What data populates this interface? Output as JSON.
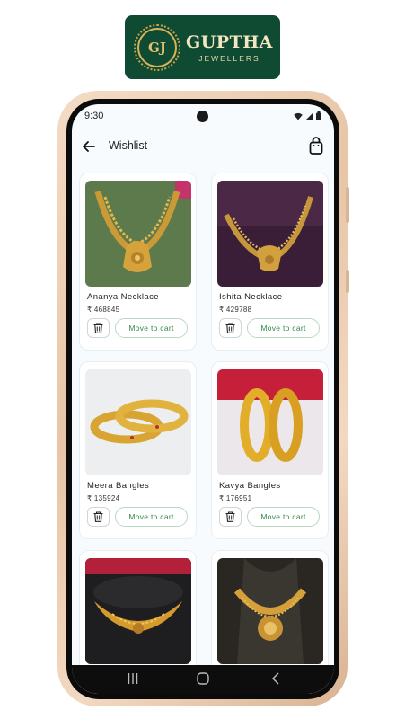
{
  "brand": {
    "mark": "GJ",
    "title": "GUPTHA",
    "subtitle": "JEWELLERS",
    "colors": {
      "primary": "#0f4a33",
      "gold": "#d9b25a",
      "accent": "#2f8a48"
    }
  },
  "status_bar": {
    "time": "9:30",
    "icons": [
      "wifi-icon",
      "signal-icon",
      "battery-icon"
    ]
  },
  "app_bar": {
    "back_icon": "arrow-left-icon",
    "title": "Wishlist",
    "bag_icon": "shopping-bag-icon"
  },
  "wishlist": [
    {
      "name": "Ananya Necklace",
      "price": "₹ 468845",
      "delete_icon": "trash-icon",
      "cart_label": "Move to cart",
      "image": "gold-necklace-green-background"
    },
    {
      "name": "Ishita Necklace",
      "price": "₹ 429788",
      "delete_icon": "trash-icon",
      "cart_label": "Move to cart",
      "image": "gold-necklace-purple-background"
    },
    {
      "name": "Meera Bangles",
      "price": "₹ 135924",
      "delete_icon": "trash-icon",
      "cart_label": "Move to cart",
      "image": "gold-bangles-white-background"
    },
    {
      "name": "Kavya Bangles",
      "price": "₹ 176951",
      "delete_icon": "trash-icon",
      "cart_label": "Move to cart",
      "image": "gold-bangles-red-background"
    },
    {
      "name": "",
      "price": "",
      "delete_icon": "",
      "cart_label": "",
      "image": "gold-choker-dark-background"
    },
    {
      "name": "",
      "price": "",
      "delete_icon": "",
      "cart_label": "",
      "image": "gold-necklace-bust-background"
    }
  ],
  "nav_bar": {
    "icons": [
      "recents-icon",
      "home-icon",
      "back-icon"
    ]
  }
}
